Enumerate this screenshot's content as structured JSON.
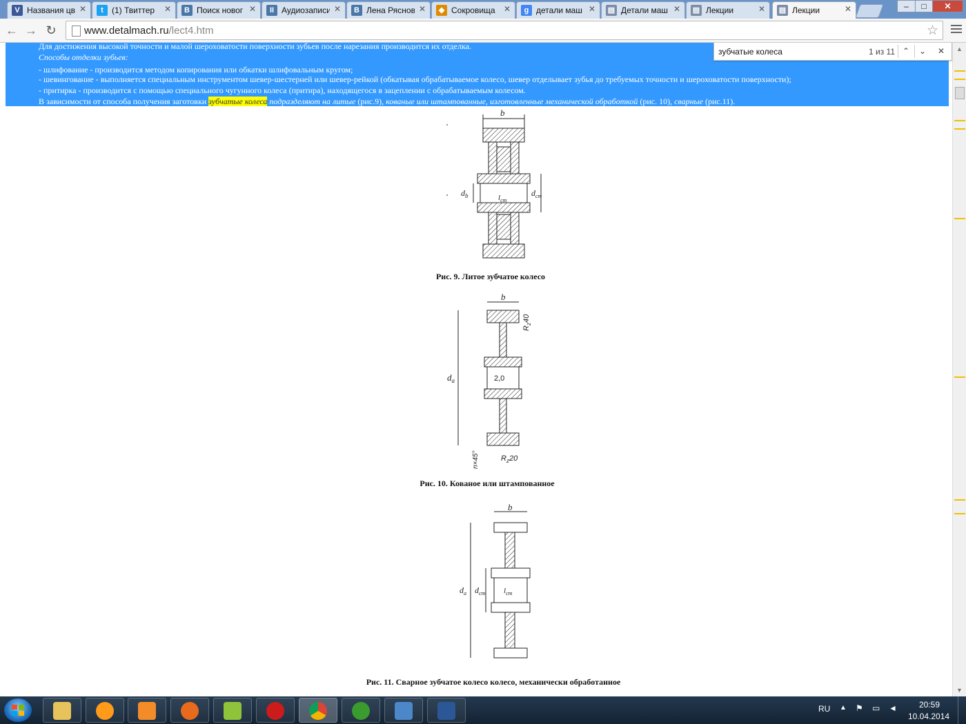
{
  "browser": {
    "tabs": [
      {
        "title": "Названия цв",
        "favicon": "V",
        "favicon_color": "#3b5998",
        "active": false
      },
      {
        "title": "(1) Твиттер",
        "favicon": "t",
        "favicon_color": "#1da1f2",
        "active": false
      },
      {
        "title": "Поиск новог",
        "favicon": "B",
        "favicon_color": "#4a76a8",
        "active": false
      },
      {
        "title": "Аудиозаписи",
        "favicon": "II",
        "favicon_color": "#4a76a8",
        "active": false
      },
      {
        "title": "Лена Ряснов",
        "favicon": "B",
        "favicon_color": "#4a76a8",
        "active": false
      },
      {
        "title": "Сокровища",
        "favicon": "◆",
        "favicon_color": "#e08a00",
        "active": false
      },
      {
        "title": "детали маш",
        "favicon": "g",
        "favicon_color": "#4285f4",
        "active": false
      },
      {
        "title": "Детали маш",
        "favicon": "▤",
        "favicon_color": "#7a8ca8",
        "active": false
      },
      {
        "title": "Лекции",
        "favicon": "▤",
        "favicon_color": "#7a8ca8",
        "active": false
      },
      {
        "title": "Лекции",
        "favicon": "▤",
        "favicon_color": "#7a8ca8",
        "active": true
      }
    ],
    "window_controls": {
      "minimize": "–",
      "maximize": "□",
      "close": "✕"
    },
    "nav": {
      "back": "←",
      "forward": "→",
      "reload": "↻"
    },
    "url_host": "www.detalmach.ru",
    "url_path": "/lect4.htm",
    "star": "☆"
  },
  "find": {
    "query": "зубчатые колеса",
    "count": "1 из 11",
    "prev": "⌃",
    "next": "⌄",
    "close": "✕"
  },
  "text": {
    "line1": "Для достижения высокой точности и малой шероховатости поверхности зубьев после нарезания производится их отделка.",
    "line2": "Способы отделки зубьев:",
    "line3": "- шлифование - производится методом копирования или обкатки шлифовальным кругом;",
    "line4": "- шевингование - выполняется специальным инструментом шевер-шестерней или шевер-рейкой (обкатывая обрабатываемое колесо, шевер отделывает зубья до требуемых  точности и шероховатости поверхности);",
    "line5": "- притирка - производится с помощью специального чугунного колеса (притира), находящегося в зацеплении с обрабатываемым колесом.",
    "line6_a": "В зависимости от способа получения заготовки ",
    "line6_hl": "зубчатые колеса",
    "line6_b": " подразделяют на литые",
    "line6_c": " (рис.9)",
    "line6_d": ", кованые или штампованные, изготовленные механической обработкой",
    "line6_e": " (рис. 10), ",
    "line6_f": "сварные",
    "line6_g": " (рис.11)."
  },
  "figures": {
    "fig9_caption": "Рис. 9. Литое зубчатое колесо",
    "fig10_caption": "Рис. 10. Кованое или штампованное",
    "fig11_caption": "Рис. 11. Сварное зубчатое колесо колесо, механически обработанное",
    "labels": {
      "b": "b",
      "d_b": "d",
      "d_b_sub": "b",
      "d_st": "d",
      "d_st_sub": "ст",
      "l_st": "l",
      "l_st_sub": "ст",
      "d_a": "d",
      "d_a_sub": "a",
      "rz40": "R",
      "rz40_sub": "z",
      "rz40_val": "40",
      "rz20": "R",
      "rz20_sub": "z",
      "rz20_val": "20",
      "ra": "2,0",
      "chamfer": "n×45°"
    }
  },
  "taskbar": {
    "apps": [
      {
        "name": "explorer",
        "color": "#e8c25a"
      },
      {
        "name": "orb",
        "color": "#ff9a1a"
      },
      {
        "name": "media",
        "color": "#f28c28"
      },
      {
        "name": "firefox",
        "color": "#e86a1c"
      },
      {
        "name": "game",
        "color": "#8fc43a"
      },
      {
        "name": "opera",
        "color": "#cc1b1b"
      },
      {
        "name": "chrome",
        "color": "#2f9e44"
      },
      {
        "name": "utorrent",
        "color": "#3a9c2f"
      },
      {
        "name": "viewer",
        "color": "#4c88c9"
      },
      {
        "name": "word",
        "color": "#2b5797"
      }
    ],
    "lang": "RU",
    "time": "20:59",
    "date": "10.04.2014"
  }
}
